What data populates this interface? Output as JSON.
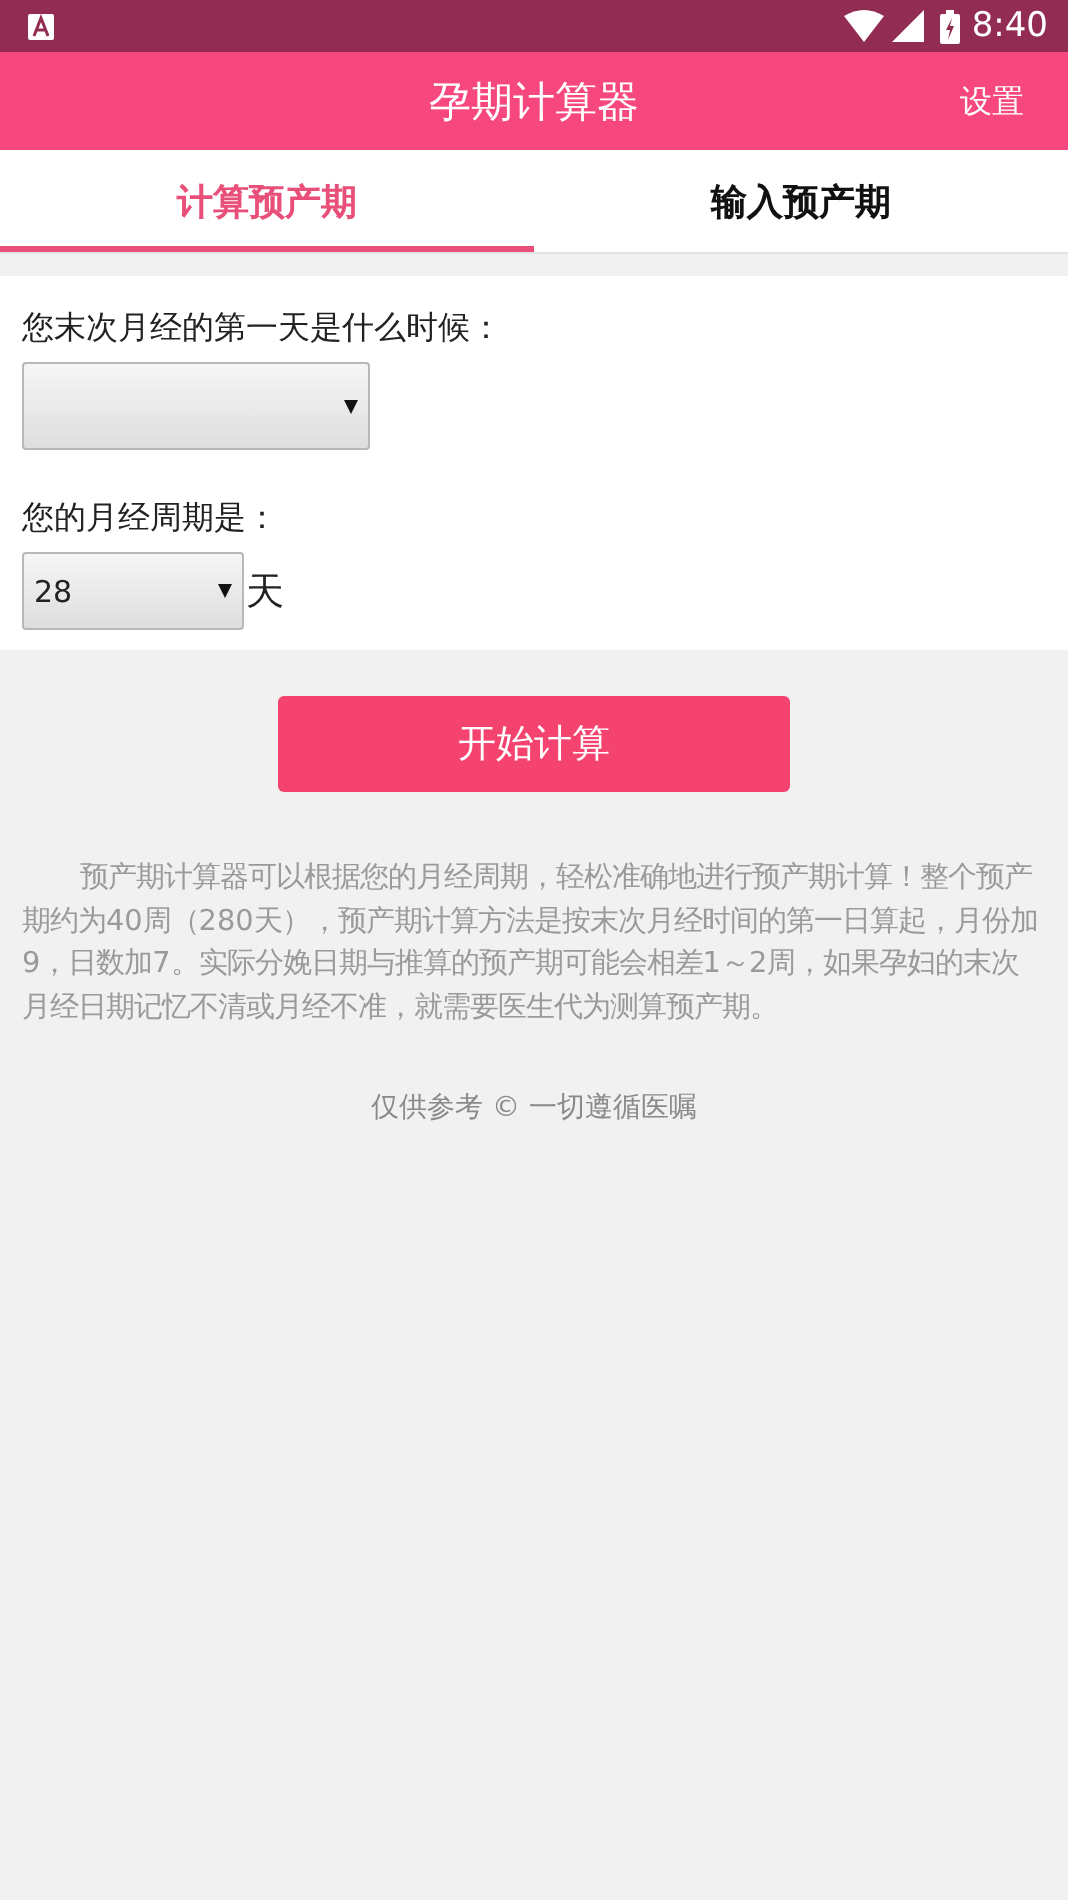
{
  "status_bar": {
    "time": "8:40"
  },
  "app_bar": {
    "title": "孕期计算器",
    "action": "设置"
  },
  "tabs": [
    {
      "label": "计算预产期",
      "selected": true
    },
    {
      "label": "输入预产期",
      "selected": false
    }
  ],
  "form": {
    "fields": [
      {
        "label": "您末次月经的第一天是什么时候：",
        "kind": "date_select"
      },
      {
        "label": "您的月经周期是：",
        "kind": "cycle_select",
        "value": "28",
        "unit": "天"
      }
    ]
  },
  "button": "开始计算",
  "description": "预产期计算器可以根据您的月经周期，轻松准确地进行预产期计算！整个预产期约为40周（280天），预产期计算方法是按末次月经时间的第一日算起，月份加 9，日数加7。实际分娩日期与推算的预产期可能会相差1～2周，如果孕妇的末次月经日期记忆不清或月经不准，就需要医生代为测算预产期。",
  "footer": "仅供参考 © 一切遵循医嘱"
}
